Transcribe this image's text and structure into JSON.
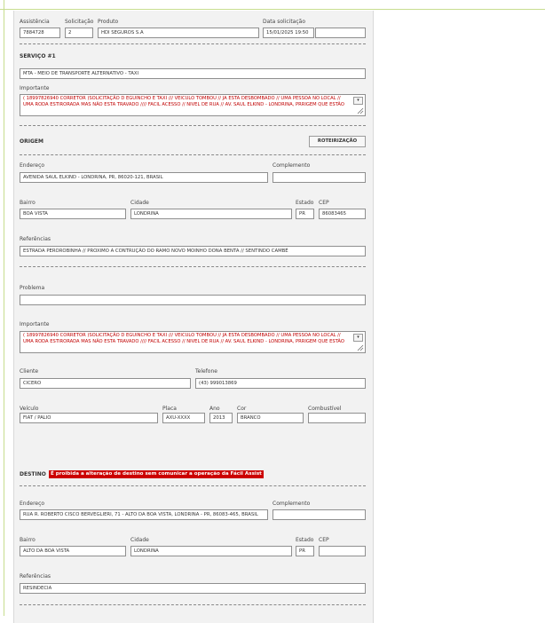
{
  "header": {
    "assistencia_label": "Assistência",
    "assistencia_value": "7884728",
    "solicitacao_label": "Solicitação",
    "solicitacao_value": "2",
    "produto_label": "Produto",
    "produto_value": "HDI SEGUROS S.A",
    "data_label": "Data solicitação",
    "data_value": "15/01/2025 19:50",
    "extra_value": ""
  },
  "servico": {
    "title": "SERVIÇO #1",
    "tipo_value": "MTA - MEIO DE TRANSPORTE ALTERNATIVO - TAXI",
    "importante_label": "Importante",
    "importante_text": "( 18997826940 CORRETOR )SOLICITAÇÃO D EGUINCHO E TAXI /// VEICULO TOMBOU // JA ESTA DESBOMBADO // UMA PESSOA NO LOCAL // UMA RODA ESTIRORADA MAS NÃO ESTA TRAVADO //// FACIL ACESSO // NIVEL DE RUA // AV. SAUL ELKIND - LONDRINA, PRRIGEM QUE ESTÃO"
  },
  "origem": {
    "title": "ORIGEM",
    "roteirizacao_label": "ROTEIRIZAÇÃO",
    "endereco_label": "Endereço",
    "endereco_value": "AVENIDA SAUL ELKIND - LONDRINA, PR, 86020-121, BRASIL",
    "complemento_label": "Complemento",
    "complemento_value": "",
    "bairro_label": "Bairro",
    "bairro_value": "BOA VISTA",
    "cidade_label": "Cidade",
    "cidade_value": "LONDRINA",
    "estado_label": "Estado",
    "estado_value": "PR",
    "cep_label": "CEP",
    "cep_value": "86083465",
    "referencias_label": "Referências",
    "referencias_value": "ESTRADA PEROROBINHA // PROXIMO A CONTRUÇÃO DO RAMO NOVO MOINHO DONA BENTA // SENTINDO CAMBÉ"
  },
  "detalhes": {
    "problema_label": "Problema",
    "problema_value": "",
    "importante_label": "Importante",
    "importante_text": "( 18997826940 CORRETOR )SOLICITAÇÃO D EGUINCHO E TAXI /// VEICULO TOMBOU // JA ESTA DESBOMBADO // UMA PESSOA NO LOCAL // UMA RODA ESTIRORADA MAS NÃO ESTA TRAVADO //// FACIL ACESSO // NIVEL DE RUA // AV. SAUL ELKIND - LONDRINA, PRRIGEM QUE ESTÃO",
    "cliente_label": "Cliente",
    "cliente_value": "CICERO",
    "telefone_label": "Telefone",
    "telefone_value": "(43) 999013869",
    "veiculo_label": "Veículo",
    "veiculo_value": "FIAT / PALIO",
    "placa_label": "Placa",
    "placa_value": "AXU-XXXX",
    "ano_label": "Ano",
    "ano_value": "2013",
    "cor_label": "Cor",
    "cor_value": "BRANCO",
    "combustivel_label": "Combustível",
    "combustivel_value": ""
  },
  "destino": {
    "title": "DESTINO",
    "warning": "É proibida a alteração de destino sem comunicar a operação da Fácil Assist",
    "endereco_label": "Endereço",
    "endereco_value": "RUA R. ROBERTO CISCO BERVEGLIERI, 71 - ALTO DA BOA VISTA, LONDRINA - PR, 86083-465, BRASIL",
    "complemento_label": "Complemento",
    "complemento_value": "",
    "bairro_label": "Bairro",
    "bairro_value": "ALTO DA BOA VISTA",
    "cidade_label": "Cidade",
    "cidade_value": "LONDRINA",
    "estado_label": "Estado",
    "estado_value": "PR",
    "cep_label": "CEP",
    "cep_value": "",
    "referencias_label": "Referências",
    "referencias_value": "RESINDECIA"
  },
  "colors": {
    "warning_bg": "#cc0000",
    "important_text": "#c00000",
    "frame_accent": "#c7dd8f"
  }
}
